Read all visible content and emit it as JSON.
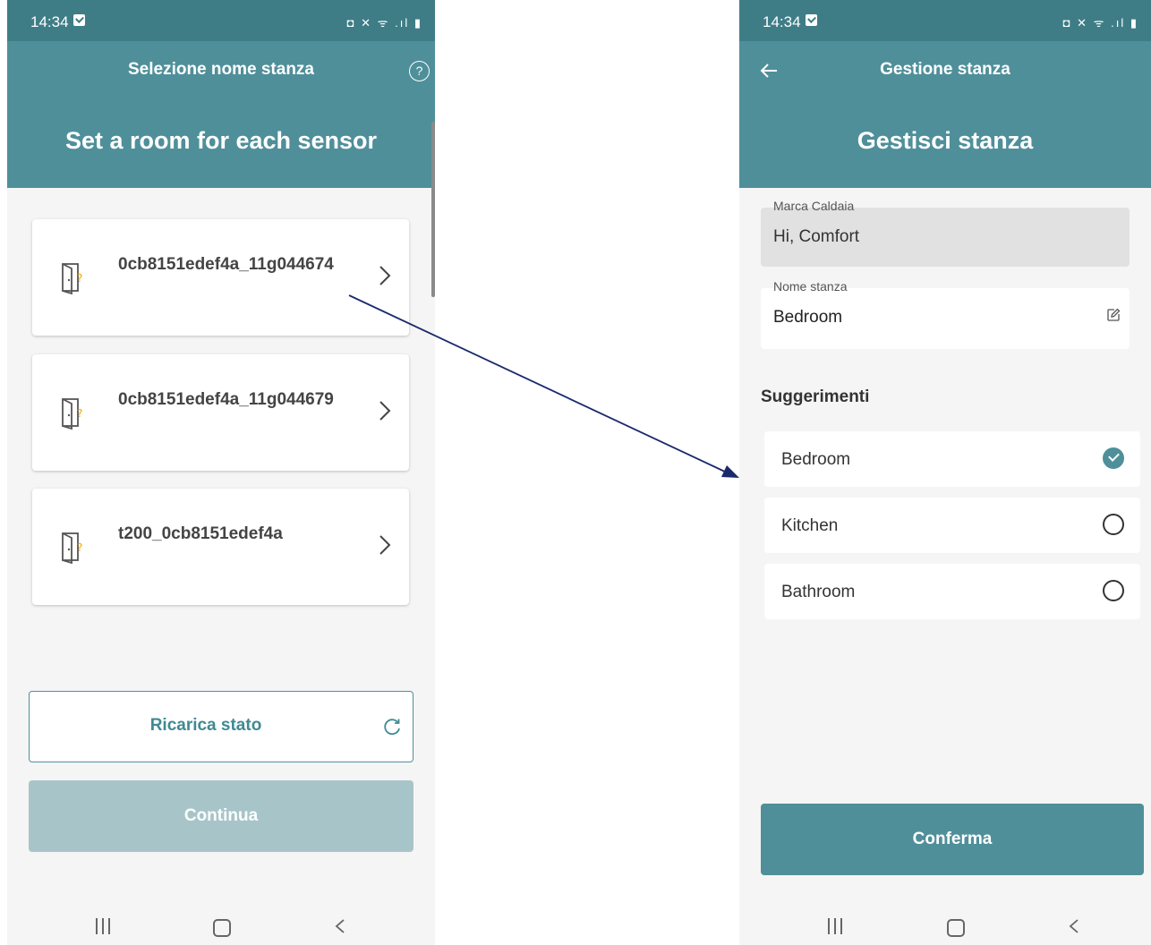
{
  "status_bar": {
    "time": "14:34",
    "icons": "◘ ✕ ᯤ .ıl ▮"
  },
  "left": {
    "header_title": "Selezione nome stanza",
    "heading": "Set a room for each sensor",
    "help_icon": "help-icon",
    "sensors": [
      {
        "name": "0cb8151edef4a_11g044674",
        "icon": "door-question-icon"
      },
      {
        "name": "0cb8151edef4a_11g044679",
        "icon": "door-question-icon"
      },
      {
        "name": "t200_0cb8151edef4a",
        "icon": "door-question-icon"
      }
    ],
    "reload_label": "Ricarica stato",
    "continue_label": "Continua"
  },
  "right": {
    "header_title": "Gestione stanza",
    "heading": "Gestisci stanza",
    "brand_field": {
      "label": "Marca Caldaia",
      "value": "Hi, Comfort"
    },
    "room_name_field": {
      "label": "Nome stanza",
      "value": "Bedroom"
    },
    "suggestions_title": "Suggerimenti",
    "suggestions": [
      {
        "label": "Bedroom",
        "selected": true
      },
      {
        "label": "Kitchen",
        "selected": false
      },
      {
        "label": "Bathroom",
        "selected": false
      }
    ],
    "confirm_label": "Conferma"
  },
  "colors": {
    "header": "#4f8f9a",
    "status_bar": "#3f7d86",
    "accent": "#3f8a93",
    "disabled": "#a7c5c9",
    "arrow": "#1a2a6c"
  }
}
